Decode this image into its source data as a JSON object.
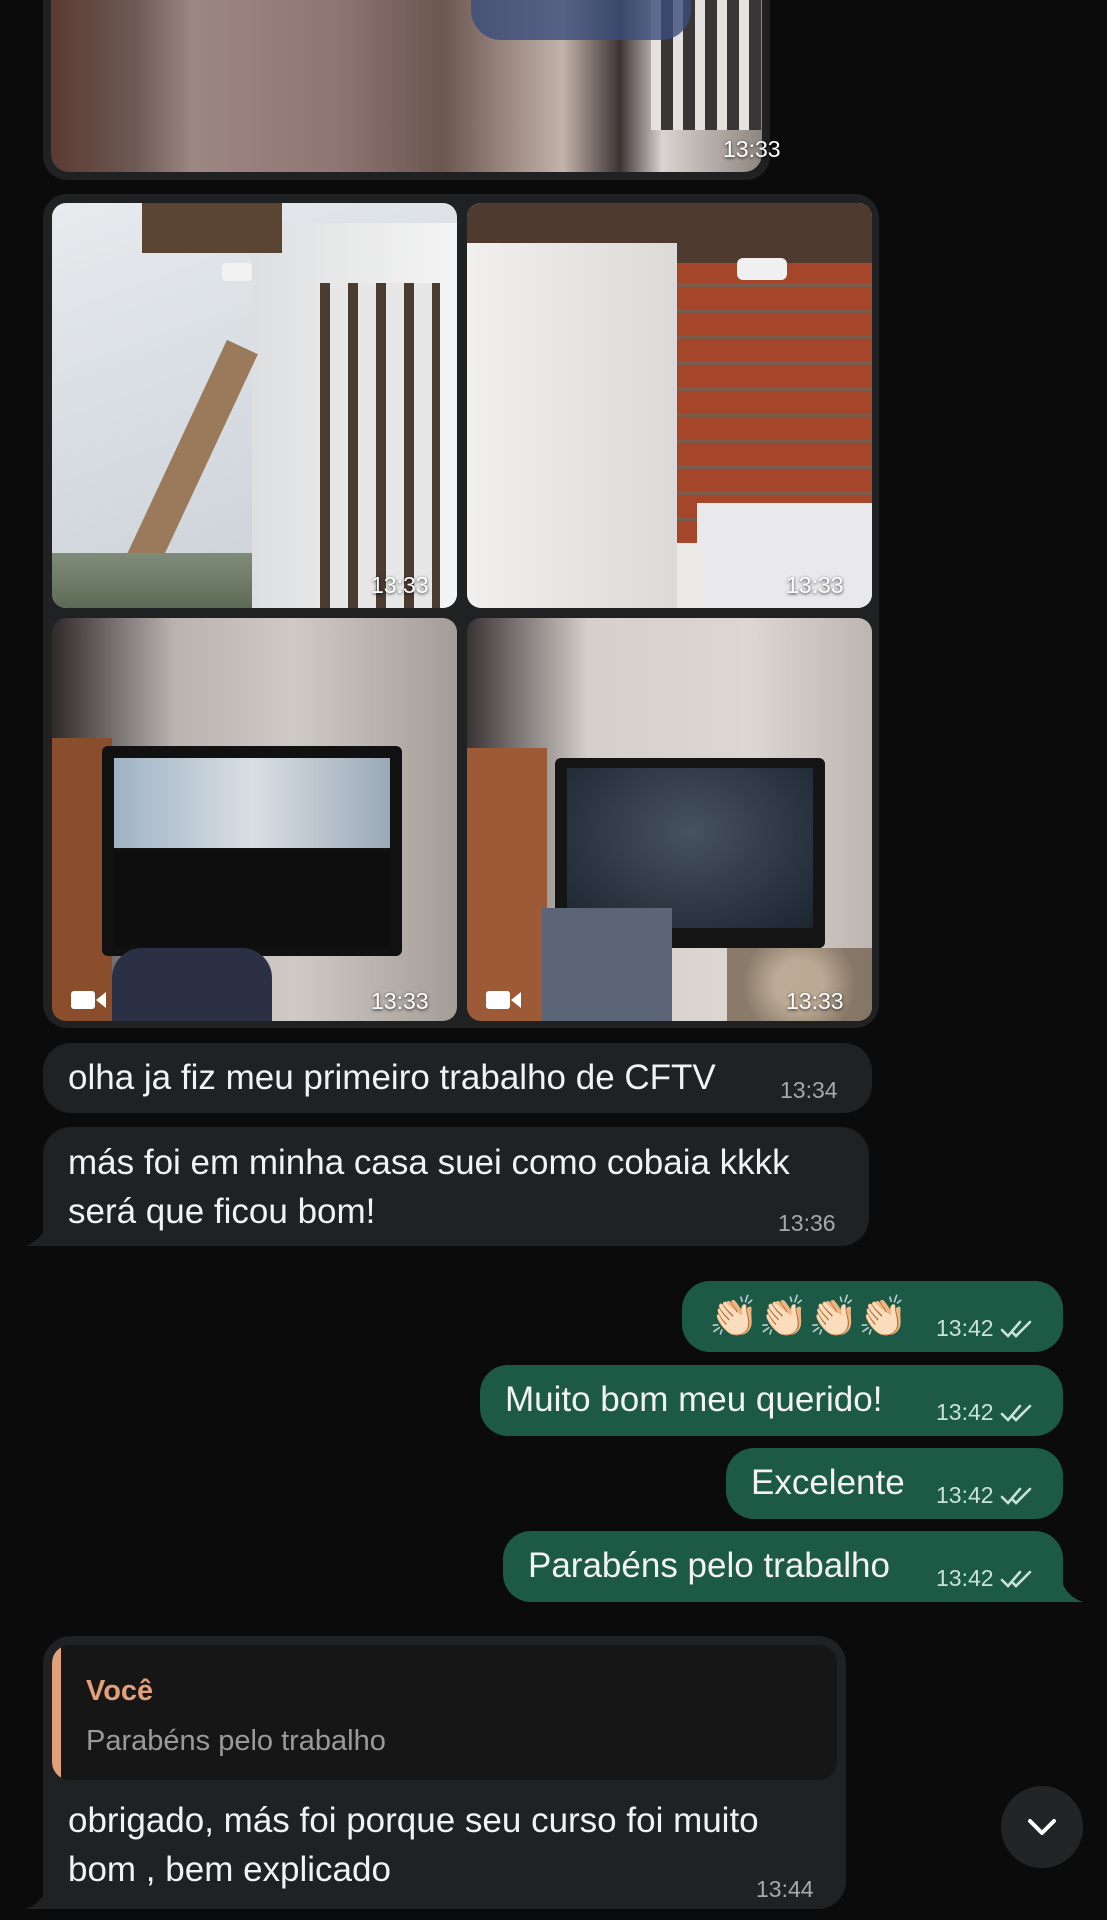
{
  "media_top": {
    "time": "13:33"
  },
  "media_grid": {
    "items": [
      {
        "time": "13:33",
        "video": false,
        "desc": "camera on wall"
      },
      {
        "time": "13:33",
        "video": false,
        "desc": "camera on brick wall"
      },
      {
        "time": "13:33",
        "video": true,
        "desc": "monitor with camera feed"
      },
      {
        "time": "13:33",
        "video": true,
        "desc": "monitor dark screen"
      }
    ]
  },
  "messages": [
    {
      "id": "m1",
      "dir": "in",
      "text": "olha ja fiz meu primeiro trabalho de CFTV",
      "time": "13:34"
    },
    {
      "id": "m2",
      "dir": "in",
      "text_lines": [
        "más foi em minha casa suei como cobaia kkkk",
        "será que ficou bom!"
      ],
      "time": "13:36"
    },
    {
      "id": "m3",
      "dir": "out",
      "text": "👏🏻👏🏻👏🏻👏🏻",
      "time": "13:42"
    },
    {
      "id": "m4",
      "dir": "out",
      "text": "Muito bom meu querido!",
      "time": "13:42"
    },
    {
      "id": "m5",
      "dir": "out",
      "text": "Excelente",
      "time": "13:42"
    },
    {
      "id": "m6",
      "dir": "out",
      "text": "Parabéns pelo trabalho",
      "time": "13:42"
    },
    {
      "id": "m7",
      "dir": "in",
      "reply": {
        "author": "Você",
        "text": "Parabéns pelo trabalho"
      },
      "text_lines": [
        "obrigado, más foi porque seu curso foi muito",
        "bom , bem explicado"
      ],
      "time": "13:44"
    }
  ],
  "icons": {
    "read_receipt": "double-check-icon",
    "video": "video-camera-icon",
    "scroll_down": "chevron-down-icon"
  },
  "colors": {
    "background": "#0b0b0b",
    "incoming": "#202123",
    "outgoing": "#1d5a45",
    "reply_accent": "#e0a07a"
  }
}
